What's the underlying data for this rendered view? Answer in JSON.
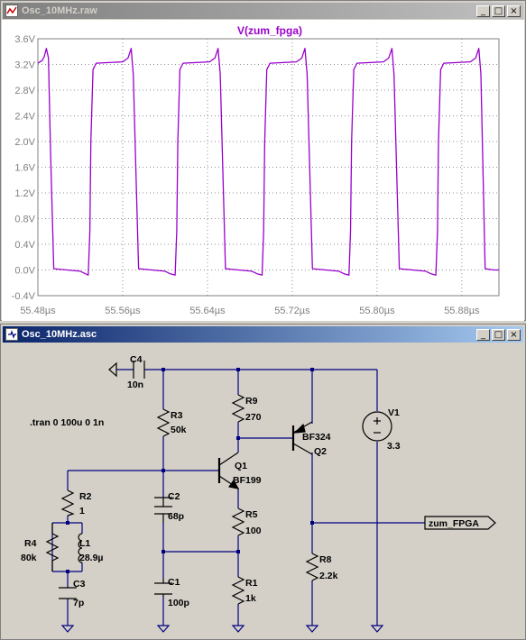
{
  "waveform_window": {
    "title": "Osc_10MHz.raw",
    "trace_label": "V(zum_fpga)",
    "trace_color": "#9900cc"
  },
  "schematic_window": {
    "title": "Osc_10MHz.asc",
    "directive": ".tran 0 100u 0 1n",
    "net_label": "zum_FPGA",
    "components": {
      "C4": {
        "name": "C4",
        "value": "10n"
      },
      "R3": {
        "name": "R3",
        "value": "50k"
      },
      "R9": {
        "name": "R9",
        "value": "270"
      },
      "Q1": {
        "name": "Q1",
        "value": "BF199"
      },
      "Q2": {
        "name": "Q2",
        "value": "BF324"
      },
      "V1": {
        "name": "V1",
        "value": "3.3"
      },
      "R2": {
        "name": "R2",
        "value": "1"
      },
      "R4": {
        "name": "R4",
        "value": "80k"
      },
      "L1": {
        "name": "L1",
        "value": "28.9µ"
      },
      "C3": {
        "name": "C3",
        "value": "7p"
      },
      "C2": {
        "name": "C2",
        "value": "68p"
      },
      "C1": {
        "name": "C1",
        "value": "100p"
      },
      "R5": {
        "name": "R5",
        "value": "100"
      },
      "R1": {
        "name": "R1",
        "value": "1k"
      },
      "R8": {
        "name": "R8",
        "value": "2.2k"
      }
    },
    "wire_color": "#000080",
    "component_color": "#000000"
  },
  "window_buttons": {
    "minimize": "_",
    "maximize": "□",
    "close": "×"
  },
  "chart_data": {
    "type": "line",
    "title": "V(zum_fpga)",
    "xlabel": "",
    "ylabel": "",
    "x_ticks": [
      "55.48µs",
      "55.56µs",
      "55.64µs",
      "55.72µs",
      "55.80µs",
      "55.88µs"
    ],
    "y_ticks": [
      "-0.4V",
      "0.0V",
      "0.4V",
      "0.8V",
      "1.2V",
      "1.6V",
      "2.0V",
      "2.4V",
      "2.8V",
      "3.2V",
      "3.6V"
    ],
    "xlim": [
      55.48,
      55.915
    ],
    "ylim": [
      -0.4,
      3.6
    ],
    "grid": true,
    "series": [
      {
        "name": "V(zum_fpga)",
        "x": [
          55.48,
          55.484,
          55.486,
          55.488,
          55.49,
          55.492,
          55.495,
          55.52,
          55.525,
          55.5275,
          55.529,
          55.53,
          55.532,
          55.535,
          55.56,
          55.565,
          55.568,
          55.57,
          55.575,
          55.6,
          55.605,
          55.6095,
          55.611,
          55.612,
          55.614,
          55.617,
          55.642,
          55.647,
          55.65,
          55.652,
          55.657,
          55.682,
          55.687,
          55.6915,
          55.693,
          55.694,
          55.696,
          55.699,
          55.724,
          55.729,
          55.732,
          55.734,
          55.739,
          55.764,
          55.769,
          55.7735,
          55.775,
          55.776,
          55.778,
          55.781,
          55.806,
          55.811,
          55.814,
          55.816,
          55.821,
          55.846,
          55.851,
          55.8555,
          55.857,
          55.858,
          55.86,
          55.863,
          55.888,
          55.893,
          55.896,
          55.898,
          55.902,
          55.91,
          55.913,
          55.915
        ],
        "y": [
          3.22,
          3.26,
          3.32,
          3.45,
          3.3,
          1.8,
          0.02,
          -0.02,
          -0.06,
          -0.08,
          0.6,
          2.0,
          3.12,
          3.22,
          3.24,
          3.3,
          3.45,
          3.05,
          0.02,
          -0.02,
          -0.06,
          -0.08,
          0.6,
          2.0,
          3.12,
          3.22,
          3.24,
          3.3,
          3.45,
          3.05,
          0.02,
          -0.02,
          -0.06,
          -0.08,
          0.6,
          2.0,
          3.12,
          3.22,
          3.24,
          3.3,
          3.45,
          3.05,
          0.02,
          -0.02,
          -0.06,
          -0.08,
          0.6,
          2.0,
          3.12,
          3.22,
          3.24,
          3.3,
          3.45,
          3.05,
          0.02,
          -0.02,
          -0.06,
          -0.08,
          0.6,
          2.0,
          3.12,
          3.22,
          3.24,
          3.3,
          3.45,
          3.05,
          0.02,
          0.0,
          0.0,
          0.0
        ]
      }
    ]
  }
}
